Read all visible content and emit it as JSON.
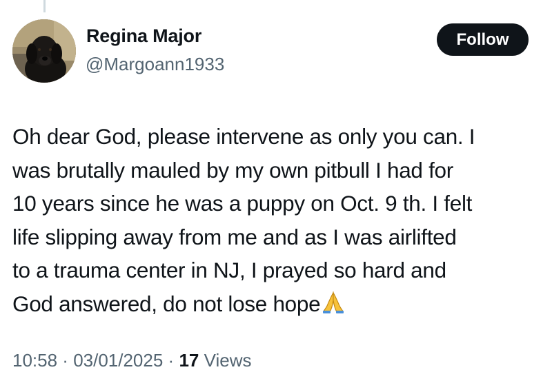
{
  "author": {
    "name": "Regina Major",
    "handle": "@Margoann1933",
    "avatar_icon": "black-labrador-puppy-avatar"
  },
  "follow_button": {
    "label": "Follow"
  },
  "tweet": {
    "lines": [
      "Oh dear God, please intervene as only you can. I",
      "was brutally mauled by my own pitbull I had for",
      "10 years since he was a puppy on Oct. 9 th. I felt",
      "life slipping away from me and as I was airlifted",
      "to a trauma center in NJ, I prayed so hard and",
      "God answered, do not lose hope"
    ],
    "trailing_emoji_icon": "praying-hands-icon"
  },
  "meta": {
    "time": "10:58",
    "separator": " · ",
    "date": "03/01/2025",
    "views_count": "17",
    "views_label": " Views"
  },
  "colors": {
    "text_primary": "#0f1419",
    "text_secondary": "#536471",
    "button_bg": "#0f1419",
    "thread_line": "#cfd9de"
  }
}
